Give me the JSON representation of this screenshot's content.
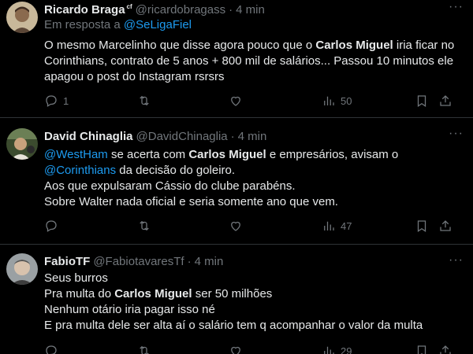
{
  "tweets": [
    {
      "name": "Ricardo Braga",
      "badge": "cf",
      "handle": "@ricardobragass",
      "sep": "·",
      "time": "4 min",
      "reply_prefix": "Em resposta a ",
      "reply_handle": "@SeLigaFiel",
      "text_parts": [
        "O mesmo Marcelinho que disse agora pouco que o ",
        "Carlos Miguel",
        " iria ficar no Corinthians, contrato de 5 anos + 800 mil de salários... Passou 10 minutos ele apagou o post do Instagram rsrsrs"
      ],
      "replies": "1",
      "retweets": "",
      "likes": "",
      "views": "50"
    },
    {
      "name": "David Chinaglia",
      "handle": "@DavidChinaglia",
      "sep": "·",
      "time": "4 min",
      "lines": [
        [
          "@WestHam",
          " se acerta com ",
          "Carlos Miguel",
          " e empresários, avisam o"
        ],
        [
          "@Corinthians",
          " da decisão do goleiro."
        ],
        [
          "Aos que expulsaram Cássio do clube parabéns."
        ],
        [
          "Sobre Walter nada oficial e seria somente ano que vem."
        ]
      ],
      "replies": "",
      "retweets": "",
      "likes": "",
      "views": "47"
    },
    {
      "name": "FabioTF",
      "handle": "@FabiotavaresTf",
      "sep": "·",
      "time": "4 min",
      "lines": [
        [
          "Seus burros"
        ],
        [
          "Pra multa do ",
          "Carlos Miguel",
          " ser 50 milhões"
        ],
        [
          "Nenhum otário iria pagar isso né"
        ],
        [
          "E pra multa dele ser alta aí o salário tem q acompanhar o valor da multa"
        ]
      ],
      "replies": "",
      "retweets": "",
      "likes": "",
      "views": "29"
    }
  ],
  "icons": {
    "reply": "reply-icon",
    "retweet": "retweet-icon",
    "like": "heart-icon",
    "views": "views-icon",
    "bookmark": "bookmark-icon",
    "share": "share-icon",
    "more": "more-icon"
  },
  "more_label": "···",
  "colors": {
    "link": "#1d9bf0",
    "muted": "#71767b",
    "text": "#e7e9ea",
    "divider": "#2f3336"
  }
}
